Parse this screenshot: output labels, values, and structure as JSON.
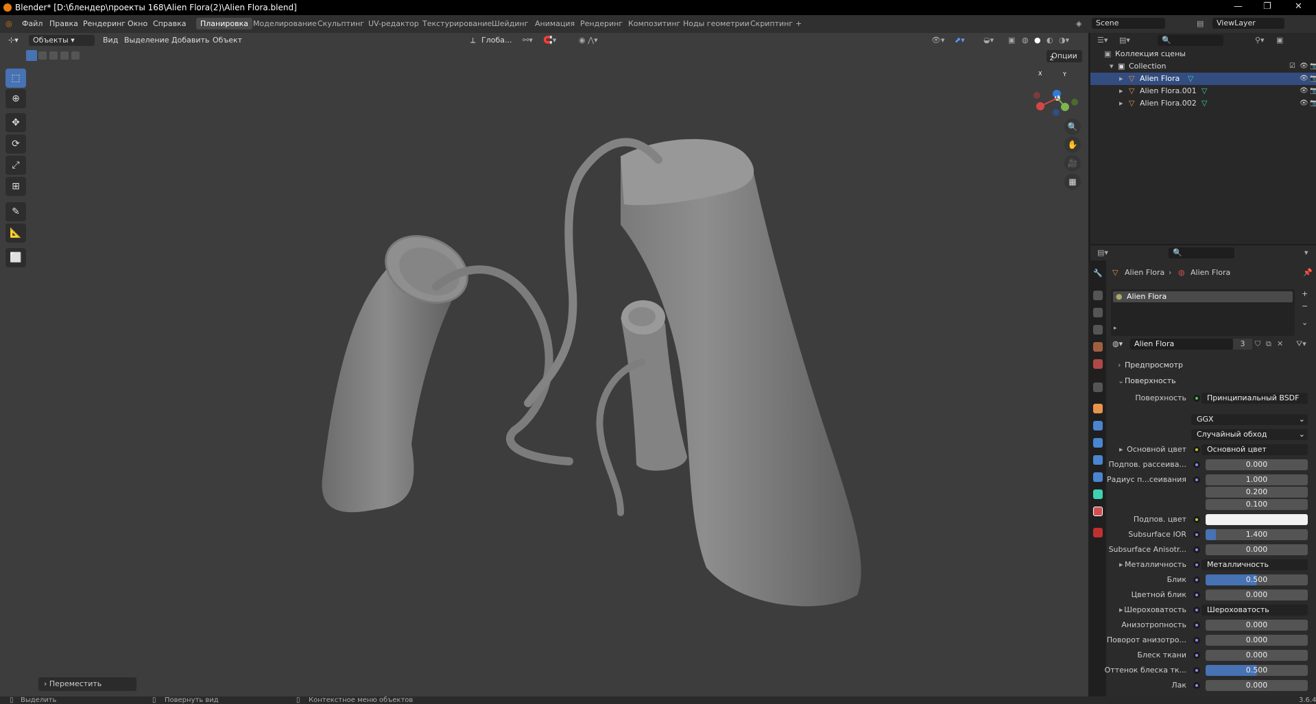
{
  "titlebar": {
    "title": "Blender* [D:\\блендер\\проекты 168\\Alien Flora(2)\\Alien Flora.blend]"
  },
  "menu": {
    "items": [
      "Файл",
      "Правка",
      "Рендеринг",
      "Окно",
      "Справка"
    ]
  },
  "workspaces": [
    "Планировка",
    "Моделирование",
    "Скульптинг",
    "UV-редактор",
    "Текстурирование",
    "Шейдинг",
    "Анимация",
    "Рендеринг",
    "Композитинг",
    "Ноды геометрии",
    "Скриптинг",
    "+"
  ],
  "scene": {
    "name": "Scene",
    "view_layer": "ViewLayer"
  },
  "viewport": {
    "mode": "Объекты",
    "menus": [
      "Вид",
      "Выделение",
      "Добавить",
      "Объект"
    ],
    "transform_orientation": "Глоба...",
    "options": "Опции",
    "last_operator": "Переместить",
    "gizmo": {
      "x": "X",
      "y": "Y",
      "z": "Z"
    }
  },
  "outliner": {
    "root": "Коллекция сцены",
    "collection": "Collection",
    "objects": [
      "Alien Flora",
      "Alien Flora.001",
      "Alien Flora.002"
    ]
  },
  "properties": {
    "breadcrumb": {
      "object": "Alien Flora",
      "material": "Alien Flora"
    },
    "slot": "Alien Flora",
    "material_name": "Alien Flora",
    "users": "3",
    "sections": {
      "preview": "Предпросмотр",
      "surface": "Поверхность"
    },
    "rows": [
      {
        "label": "Поверхность",
        "value": "Принципиальный BSDF",
        "kind": "node"
      },
      {
        "label": "",
        "value": "GGX",
        "kind": "dropdown"
      },
      {
        "label": "",
        "value": "Случайный обход",
        "kind": "dropdown"
      },
      {
        "label": "Основной цвет",
        "value": "Основной цвет",
        "kind": "node"
      },
      {
        "label": "Подпов. рассеива...",
        "value": "0.000",
        "kind": "number"
      },
      {
        "label": "Радиус п...сеивания",
        "value": "1.000",
        "kind": "number"
      },
      {
        "label": "",
        "value": "0.200",
        "kind": "number"
      },
      {
        "label": "",
        "value": "0.100",
        "kind": "number"
      },
      {
        "label": "Подпов. цвет",
        "value": "",
        "kind": "color"
      },
      {
        "label": "Subsurface IOR",
        "value": "1.400",
        "kind": "number"
      },
      {
        "label": "Subsurface Anisotr...",
        "value": "0.000",
        "kind": "number"
      },
      {
        "label": "Металличность",
        "value": "Металличность",
        "kind": "node"
      },
      {
        "label": "Блик",
        "value": "0.500",
        "kind": "slider"
      },
      {
        "label": "Цветной блик",
        "value": "0.000",
        "kind": "number"
      },
      {
        "label": "Шероховатость",
        "value": "Шероховатость",
        "kind": "node"
      },
      {
        "label": "Анизотропность",
        "value": "0.000",
        "kind": "number"
      },
      {
        "label": "Поворот анизотро...",
        "value": "0.000",
        "kind": "number"
      },
      {
        "label": "Блеск ткани",
        "value": "0.000",
        "kind": "number"
      },
      {
        "label": "Оттенок блеска тк...",
        "value": "0.500",
        "kind": "slider"
      },
      {
        "label": "Лак",
        "value": "0.000",
        "kind": "number"
      }
    ]
  },
  "statusbar": {
    "select": "Выделить",
    "rotate": "Повернуть вид",
    "context": "Контекстное меню объектов",
    "version": "3.6.4"
  },
  "colors": {
    "accent": "#4772b3",
    "selected_row": "#334d80",
    "viewport_bg": "#3d3d3d"
  }
}
